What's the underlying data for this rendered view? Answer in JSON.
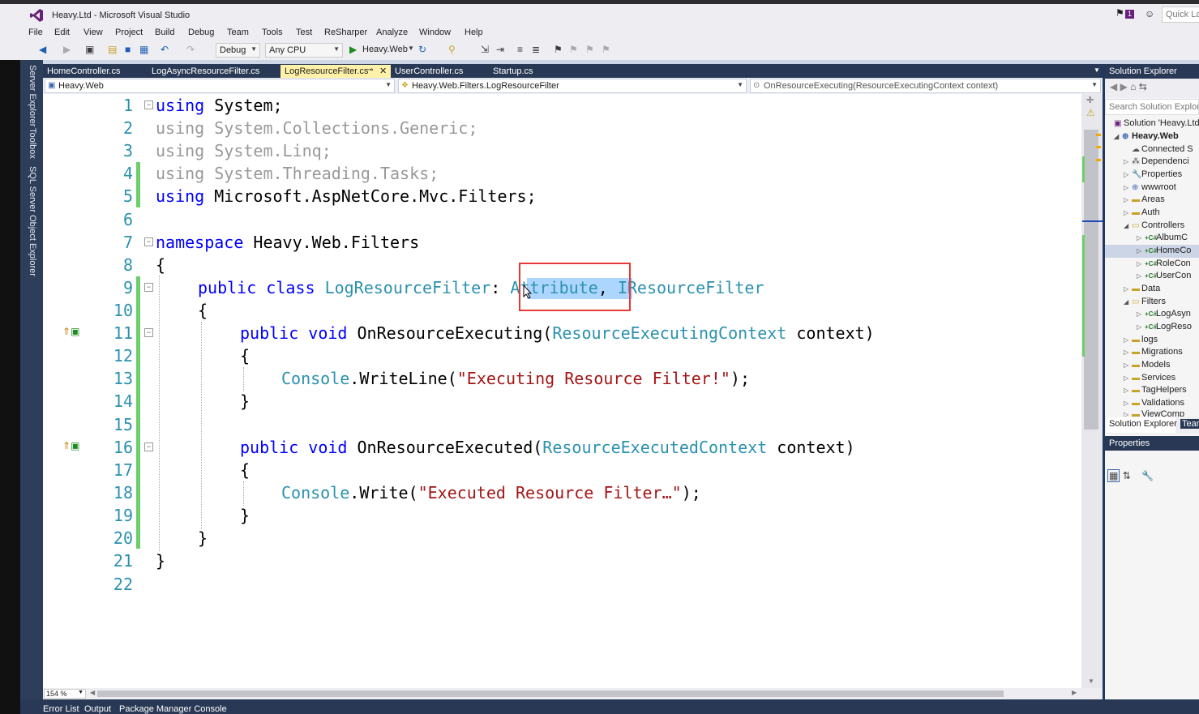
{
  "window": {
    "title": "Heavy.Ltd - Microsoft Visual Studio",
    "notification_count": "1",
    "quick_launch_placeholder": "Quick La"
  },
  "menu": [
    "File",
    "Edit",
    "View",
    "Project",
    "Build",
    "Debug",
    "Team",
    "Tools",
    "Test",
    "ReSharper",
    "Analyze",
    "Window",
    "Help"
  ],
  "toolbar": {
    "configuration": "Debug",
    "platform": "Any CPU",
    "run_target": "Heavy.Web"
  },
  "left_rail": [
    "Server Explorer",
    "Toolbox",
    "SQL Server Object Explorer"
  ],
  "tabs": [
    {
      "label": "HomeController.cs"
    },
    {
      "label": "LogAsyncResourceFilter.cs"
    },
    {
      "label": "LogResourceFilter.cs",
      "active": true
    },
    {
      "label": "UserController.cs"
    },
    {
      "label": "Startup.cs"
    }
  ],
  "navbar": {
    "project": "Heavy.Web",
    "type": "Heavy.Web.Filters.LogResourceFilter",
    "member": "OnResourceExecuting(ResourceExecutingContext context)"
  },
  "code": {
    "line_numbers": [
      "1",
      "2",
      "3",
      "4",
      "5",
      "6",
      "7",
      "8",
      "9",
      "10",
      "11",
      "12",
      "13",
      "14",
      "15",
      "16",
      "17",
      "18",
      "19",
      "20",
      "21",
      "22"
    ],
    "l1_kw": "using",
    "l1_rest": " System;",
    "l2": "using System.Collections.Generic;",
    "l3": "using System.Linq;",
    "l4": "using System.Threading.Tasks;",
    "l5_kw": "using",
    "l5_rest": " Microsoft.AspNetCore.Mvc.Filters;",
    "l7_kw": "namespace",
    "l7_rest": " Heavy.Web.Filters",
    "open_brace": "{",
    "close_brace": "}",
    "l9_kw1": "public",
    "l9_kw2": "class",
    "l9_cls": "LogResourceFilter",
    "l9_colon": ":",
    "l9_base": "Attribute",
    "l9_comma": ",",
    "l9_iface": "IResourceFilter",
    "l11_kw1": "public",
    "l11_kw2": "void",
    "l11_name": "OnResourceExecuting(",
    "l11_type": "ResourceExecutingContext",
    "l11_param": " context)",
    "l13_cls": "Console",
    "l13_call": ".WriteLine(",
    "l13_str": "\"Executing Resource Filter!\"",
    "l13_end": ");",
    "l16_kw1": "public",
    "l16_kw2": "void",
    "l16_name": "OnResourceExecuted(",
    "l16_type": "ResourceExecutedContext",
    "l16_param": " context)",
    "l18_cls": "Console",
    "l18_call": ".Write(",
    "l18_str": "\"Executed Resource Filter…\"",
    "l18_end": ");"
  },
  "status": {
    "zoom": "154 %"
  },
  "bottom_tabs": [
    "Error List",
    "Output",
    "Package Manager Console"
  ],
  "solution_explorer": {
    "title": "Solution Explorer",
    "search_placeholder": "Search Solution Explorer",
    "items": [
      "Solution 'Heavy.Ltd",
      "Heavy.Web",
      "Connected S",
      "Dependenci",
      "Properties",
      "wwwroot",
      "Areas",
      "Auth",
      "Controllers",
      "AlbumC",
      "HomeCo",
      "RoleCon",
      "UserCon",
      "Data",
      "Filters",
      "LogAsyn",
      "LogReso",
      "logs",
      "Migrations",
      "Models",
      "Services",
      "TagHelpers",
      "Validations",
      "ViewComp"
    ],
    "tab_active": "Solution Explorer",
    "tab_other": "Team"
  },
  "properties": {
    "title": "Properties"
  },
  "colors": {
    "accent": "#68217a",
    "tab_active": "#fff1a8",
    "selection": "#add6ff",
    "highlight_box": "#e53935"
  }
}
